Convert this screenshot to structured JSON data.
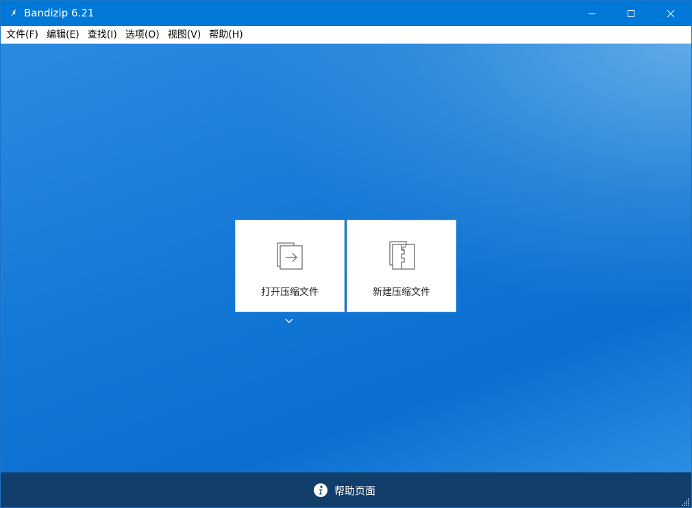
{
  "window": {
    "title": "Bandizip 6.21",
    "icon": "bandizip-logo-icon",
    "controls": {
      "minimize": "minimize-icon",
      "maximize": "maximize-icon",
      "close": "close-icon"
    }
  },
  "menu": {
    "items": [
      {
        "label": "文件(F)"
      },
      {
        "label": "编辑(E)"
      },
      {
        "label": "查找(I)"
      },
      {
        "label": "选项(O)"
      },
      {
        "label": "视图(V)"
      },
      {
        "label": "帮助(H)"
      }
    ]
  },
  "main": {
    "tiles": [
      {
        "label": "打开压缩文件",
        "icon": "open-archive-icon"
      },
      {
        "label": "新建压缩文件",
        "icon": "new-archive-icon"
      }
    ],
    "dropdown_icon": "chevron-down-icon"
  },
  "footer": {
    "help_label": "帮助页面",
    "help_icon": "info-icon"
  },
  "colors": {
    "titlebar": "#0078d7",
    "background": "#0b6fd0",
    "footer": "#123e6b"
  }
}
